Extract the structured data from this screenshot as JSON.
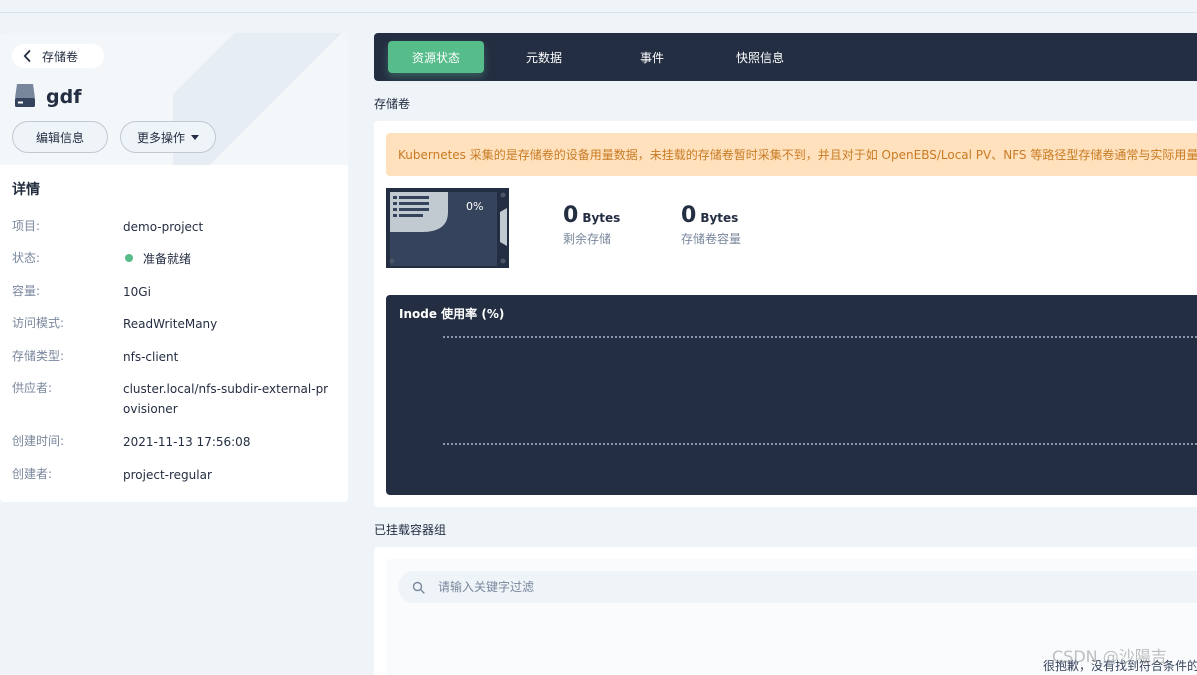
{
  "header": {
    "back_label": "存储卷",
    "volume_name": "gdf",
    "edit_label": "编辑信息",
    "more_label": "更多操作"
  },
  "details": {
    "title": "详情",
    "rows": [
      {
        "key": "项目:",
        "value": "demo-project"
      },
      {
        "key": "状态:",
        "value": "准备就绪"
      },
      {
        "key": "容量:",
        "value": "10Gi"
      },
      {
        "key": "访问模式:",
        "value": "ReadWriteMany"
      },
      {
        "key": "存储类型:",
        "value": "nfs-client"
      },
      {
        "key": "供应者:",
        "value": "cluster.local/nfs-subdir-external-provisioner"
      },
      {
        "key": "创建时间:",
        "value": "2021-11-13 17:56:08"
      },
      {
        "key": "创建者:",
        "value": "project-regular"
      }
    ],
    "status_color": "#55bc8a"
  },
  "tabs": [
    {
      "label": "资源状态",
      "active": true
    },
    {
      "label": "元数据",
      "active": false
    },
    {
      "label": "事件",
      "active": false
    },
    {
      "label": "快照信息",
      "active": false
    }
  ],
  "volume_section": {
    "label": "存储卷",
    "warning": "Kubernetes 采集的是存储卷的设备用量数据，未挂载的存储卷暂时采集不到，并且对于如 OpenEBS/Local PV、NFS 等路径型存储卷通常与实际用量有",
    "usage_percent": "0%",
    "remaining": {
      "num": "0",
      "unit": "Bytes",
      "label": "剩余存储"
    },
    "capacity": {
      "num": "0",
      "unit": "Bytes",
      "label": "存储卷容量"
    },
    "chart_title": "Inode 使用率 (%)"
  },
  "pods_section": {
    "label": "已挂载容器组",
    "search_placeholder": "请输入关键字过滤",
    "empty_text": "很抱歉，没有找到符合条件的资"
  },
  "watermark": "CSDN @沙陽吉",
  "colors": {
    "accent": "#55bc8a",
    "dark": "#242e42",
    "warning_bg": "#ffe1be",
    "warning_text": "#c97b23"
  }
}
